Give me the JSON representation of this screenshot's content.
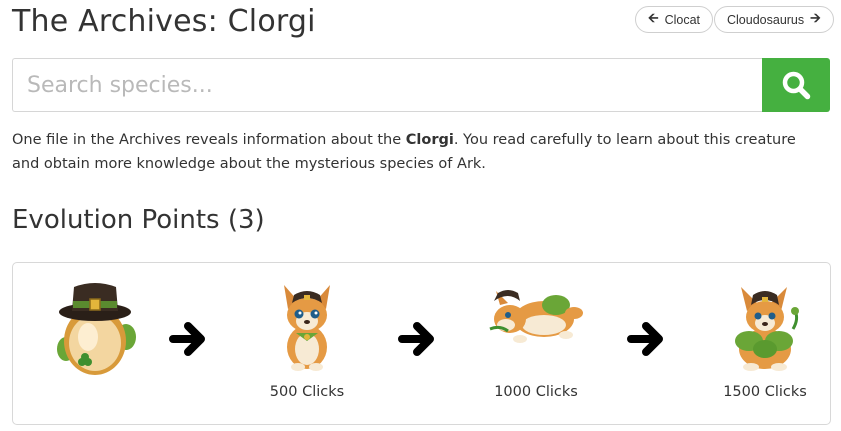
{
  "header": {
    "title": "The Archives: Clorgi",
    "prev_label": "Clocat",
    "next_label": "Cloudosaurus"
  },
  "search": {
    "placeholder": "Search species...",
    "value": ""
  },
  "description": {
    "pre": "One file in the Archives reveals information about the ",
    "species": "Clorgi",
    "post": ". You read carefully to learn about this creature and obtain more knowledge about the mysterious species of Ark."
  },
  "evolution": {
    "heading": "Evolution Points (3)",
    "stages": [
      {
        "name": "egg",
        "label": ""
      },
      {
        "name": "baby",
        "label": "500 Clicks"
      },
      {
        "name": "teen",
        "label": "1000 Clicks"
      },
      {
        "name": "adult",
        "label": "1500 Clicks"
      }
    ]
  },
  "colors": {
    "search_button": "#45b040",
    "text": "#333333",
    "border": "#d8d8d8"
  },
  "icons": {
    "search": "search-icon",
    "prev": "arrow-left-icon",
    "next": "arrow-right-icon",
    "evolution_arrow": "arrow-right-icon"
  }
}
